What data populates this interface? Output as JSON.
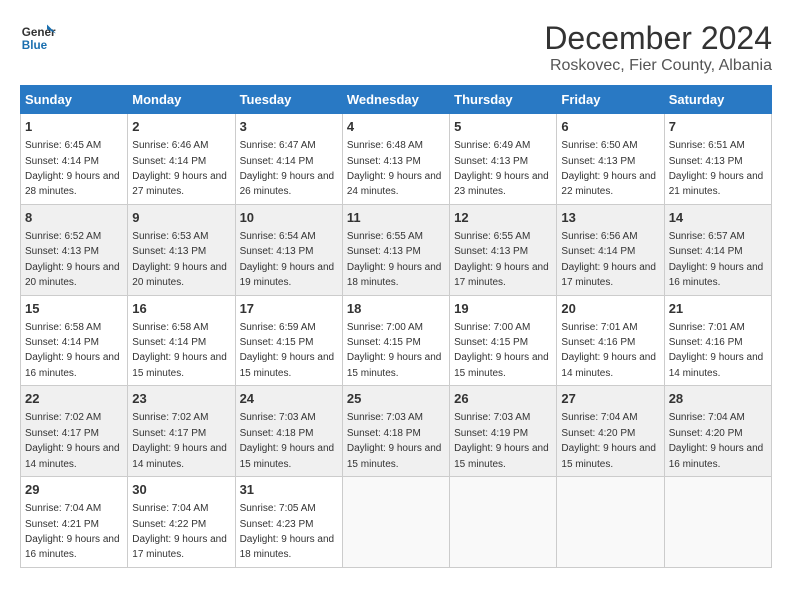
{
  "logo": {
    "line1": "General",
    "line2": "Blue"
  },
  "title": "December 2024",
  "location": "Roskovec, Fier County, Albania",
  "days_of_week": [
    "Sunday",
    "Monday",
    "Tuesday",
    "Wednesday",
    "Thursday",
    "Friday",
    "Saturday"
  ],
  "weeks": [
    [
      {
        "day": "1",
        "sunrise": "6:45 AM",
        "sunset": "4:14 PM",
        "daylight": "9 hours and 28 minutes."
      },
      {
        "day": "2",
        "sunrise": "6:46 AM",
        "sunset": "4:14 PM",
        "daylight": "9 hours and 27 minutes."
      },
      {
        "day": "3",
        "sunrise": "6:47 AM",
        "sunset": "4:14 PM",
        "daylight": "9 hours and 26 minutes."
      },
      {
        "day": "4",
        "sunrise": "6:48 AM",
        "sunset": "4:13 PM",
        "daylight": "9 hours and 24 minutes."
      },
      {
        "day": "5",
        "sunrise": "6:49 AM",
        "sunset": "4:13 PM",
        "daylight": "9 hours and 23 minutes."
      },
      {
        "day": "6",
        "sunrise": "6:50 AM",
        "sunset": "4:13 PM",
        "daylight": "9 hours and 22 minutes."
      },
      {
        "day": "7",
        "sunrise": "6:51 AM",
        "sunset": "4:13 PM",
        "daylight": "9 hours and 21 minutes."
      }
    ],
    [
      {
        "day": "8",
        "sunrise": "6:52 AM",
        "sunset": "4:13 PM",
        "daylight": "9 hours and 20 minutes."
      },
      {
        "day": "9",
        "sunrise": "6:53 AM",
        "sunset": "4:13 PM",
        "daylight": "9 hours and 20 minutes."
      },
      {
        "day": "10",
        "sunrise": "6:54 AM",
        "sunset": "4:13 PM",
        "daylight": "9 hours and 19 minutes."
      },
      {
        "day": "11",
        "sunrise": "6:55 AM",
        "sunset": "4:13 PM",
        "daylight": "9 hours and 18 minutes."
      },
      {
        "day": "12",
        "sunrise": "6:55 AM",
        "sunset": "4:13 PM",
        "daylight": "9 hours and 17 minutes."
      },
      {
        "day": "13",
        "sunrise": "6:56 AM",
        "sunset": "4:14 PM",
        "daylight": "9 hours and 17 minutes."
      },
      {
        "day": "14",
        "sunrise": "6:57 AM",
        "sunset": "4:14 PM",
        "daylight": "9 hours and 16 minutes."
      }
    ],
    [
      {
        "day": "15",
        "sunrise": "6:58 AM",
        "sunset": "4:14 PM",
        "daylight": "9 hours and 16 minutes."
      },
      {
        "day": "16",
        "sunrise": "6:58 AM",
        "sunset": "4:14 PM",
        "daylight": "9 hours and 15 minutes."
      },
      {
        "day": "17",
        "sunrise": "6:59 AM",
        "sunset": "4:15 PM",
        "daylight": "9 hours and 15 minutes."
      },
      {
        "day": "18",
        "sunrise": "7:00 AM",
        "sunset": "4:15 PM",
        "daylight": "9 hours and 15 minutes."
      },
      {
        "day": "19",
        "sunrise": "7:00 AM",
        "sunset": "4:15 PM",
        "daylight": "9 hours and 15 minutes."
      },
      {
        "day": "20",
        "sunrise": "7:01 AM",
        "sunset": "4:16 PM",
        "daylight": "9 hours and 14 minutes."
      },
      {
        "day": "21",
        "sunrise": "7:01 AM",
        "sunset": "4:16 PM",
        "daylight": "9 hours and 14 minutes."
      }
    ],
    [
      {
        "day": "22",
        "sunrise": "7:02 AM",
        "sunset": "4:17 PM",
        "daylight": "9 hours and 14 minutes."
      },
      {
        "day": "23",
        "sunrise": "7:02 AM",
        "sunset": "4:17 PM",
        "daylight": "9 hours and 14 minutes."
      },
      {
        "day": "24",
        "sunrise": "7:03 AM",
        "sunset": "4:18 PM",
        "daylight": "9 hours and 15 minutes."
      },
      {
        "day": "25",
        "sunrise": "7:03 AM",
        "sunset": "4:18 PM",
        "daylight": "9 hours and 15 minutes."
      },
      {
        "day": "26",
        "sunrise": "7:03 AM",
        "sunset": "4:19 PM",
        "daylight": "9 hours and 15 minutes."
      },
      {
        "day": "27",
        "sunrise": "7:04 AM",
        "sunset": "4:20 PM",
        "daylight": "9 hours and 15 minutes."
      },
      {
        "day": "28",
        "sunrise": "7:04 AM",
        "sunset": "4:20 PM",
        "daylight": "9 hours and 16 minutes."
      }
    ],
    [
      {
        "day": "29",
        "sunrise": "7:04 AM",
        "sunset": "4:21 PM",
        "daylight": "9 hours and 16 minutes."
      },
      {
        "day": "30",
        "sunrise": "7:04 AM",
        "sunset": "4:22 PM",
        "daylight": "9 hours and 17 minutes."
      },
      {
        "day": "31",
        "sunrise": "7:05 AM",
        "sunset": "4:23 PM",
        "daylight": "9 hours and 18 minutes."
      },
      null,
      null,
      null,
      null
    ]
  ]
}
